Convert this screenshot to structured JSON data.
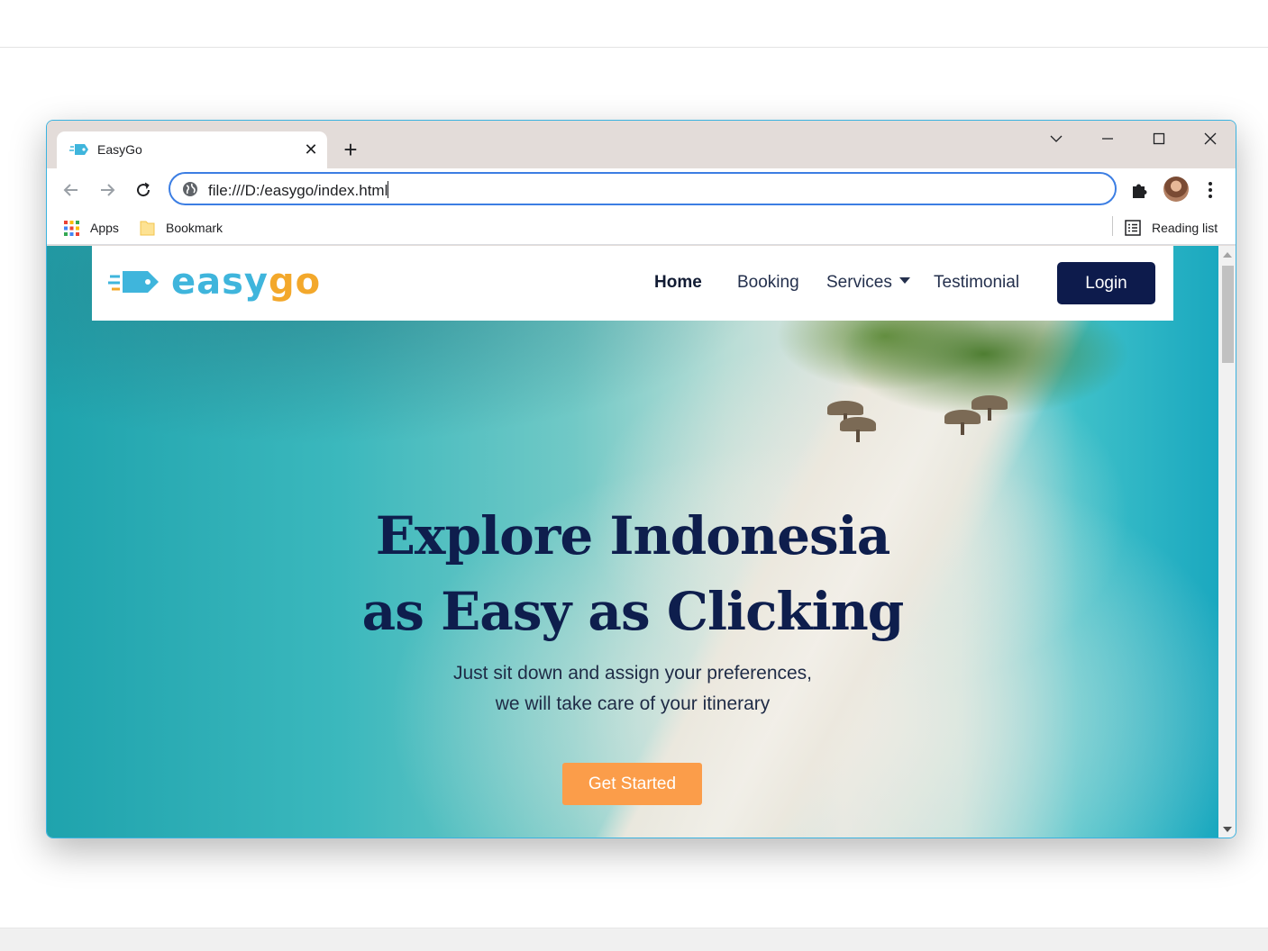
{
  "browser": {
    "tab": {
      "title": "EasyGo",
      "favicon": "easygo-tag-icon",
      "close_icon": "close-icon"
    },
    "new_tab_icon": "plus-icon",
    "window_controls": [
      "tab-search-chevron-icon",
      "minimize-icon",
      "maximize-icon",
      "close-icon"
    ],
    "nav_icons": [
      "back-arrow-icon",
      "forward-arrow-icon",
      "reload-icon"
    ],
    "address": {
      "url": "file:///D:/easygo/index.html",
      "icon": "globe-icon"
    },
    "toolbar_icons": [
      "extensions-puzzle-icon",
      "profile-avatar",
      "more-menu-icon"
    ],
    "bookmarks": {
      "items": [
        {
          "label": "Apps",
          "icon": "apps-grid-icon"
        },
        {
          "label": "Bookmark",
          "icon": "folder-icon"
        }
      ],
      "reading_list": {
        "label": "Reading list",
        "icon": "reading-list-icon"
      }
    }
  },
  "site": {
    "logo": {
      "easy": "easy",
      "go": "go",
      "icon": "tag-logo-icon"
    },
    "nav": {
      "home": "Home",
      "booking": "Booking",
      "services": "Services",
      "testimonial": "Testimonial",
      "login": "Login"
    },
    "hero": {
      "title_line1": "Explore Indonesia",
      "title_line2": "as Easy as Clicking",
      "subtitle_line1": "Just sit down and assign your preferences,",
      "subtitle_line2": "we will take care of your itinerary",
      "cta": "Get Started"
    }
  },
  "colors": {
    "window_border": "#3bb3e0",
    "tabstrip": "#e3dcd9",
    "omnibox_focus": "#3c7ee3",
    "logo_blue": "#3fb5dc",
    "logo_orange": "#f3a82b",
    "navy": "#0d1b4c",
    "cta_orange": "#fb9d4a"
  }
}
